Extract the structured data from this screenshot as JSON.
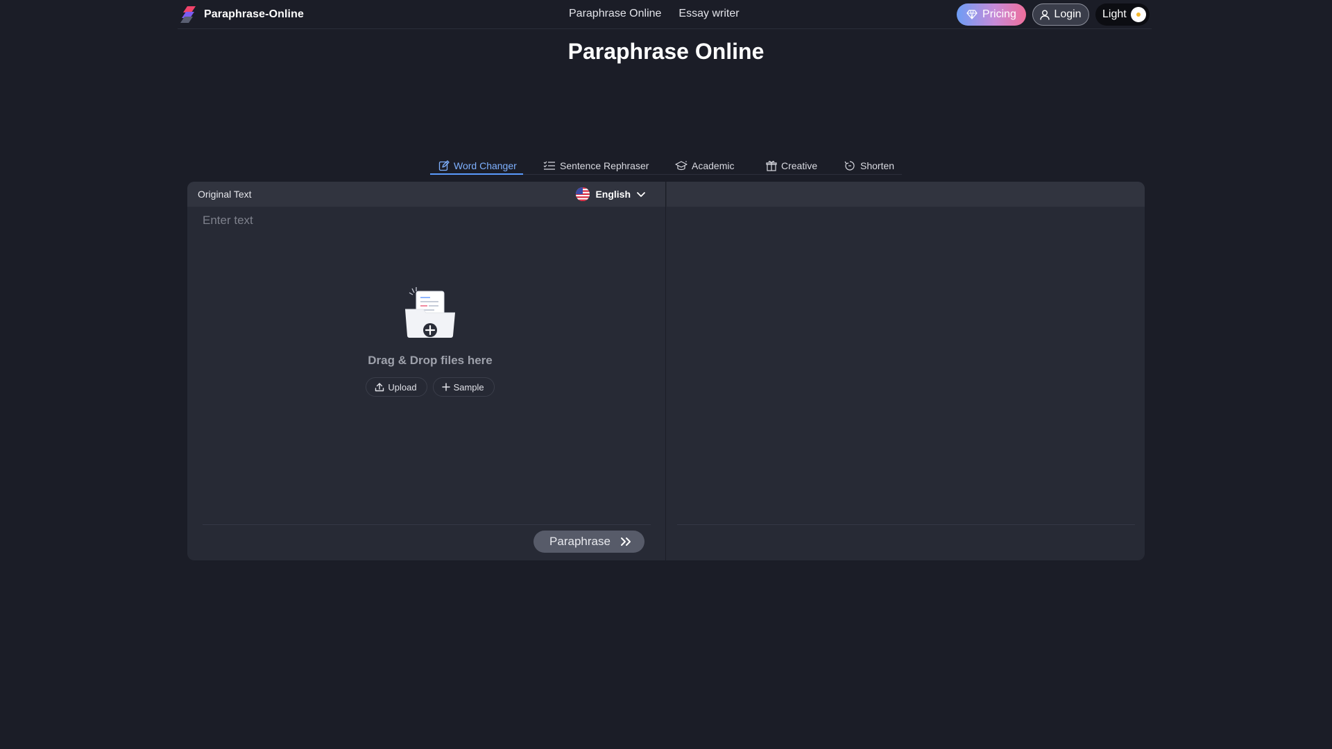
{
  "header": {
    "logo_text": "Paraphrase-Online",
    "nav": [
      {
        "label": "Paraphrase Online"
      },
      {
        "label": "Essay writer"
      }
    ],
    "pricing_label": "Pricing",
    "login_label": "Login",
    "theme_label": "Light"
  },
  "page": {
    "title": "Paraphrase Online"
  },
  "tabs": [
    {
      "label": "Word Changer",
      "icon": "edit-icon",
      "active": true
    },
    {
      "label": "Sentence Rephraser",
      "icon": "list-icon",
      "active": false
    },
    {
      "label": "Academic",
      "icon": "graduation-cap-icon",
      "active": false
    },
    {
      "label": "Creative",
      "icon": "gift-icon",
      "active": false
    },
    {
      "label": "Shorten",
      "icon": "shrink-icon",
      "active": false
    }
  ],
  "editor": {
    "original_label": "Original Text",
    "language": "English",
    "placeholder": "Enter text",
    "drop_text": "Drag & Drop files here",
    "upload_label": "Upload",
    "sample_label": "Sample",
    "paraphrase_label": "Paraphrase"
  },
  "colors": {
    "background": "#1b1d27",
    "panel": "#272a35",
    "panel_header": "#31343f",
    "accent": "#5b9bff",
    "pricing_gradient": [
      "#6d9df5",
      "#c78bd8",
      "#ef6f9b"
    ]
  }
}
